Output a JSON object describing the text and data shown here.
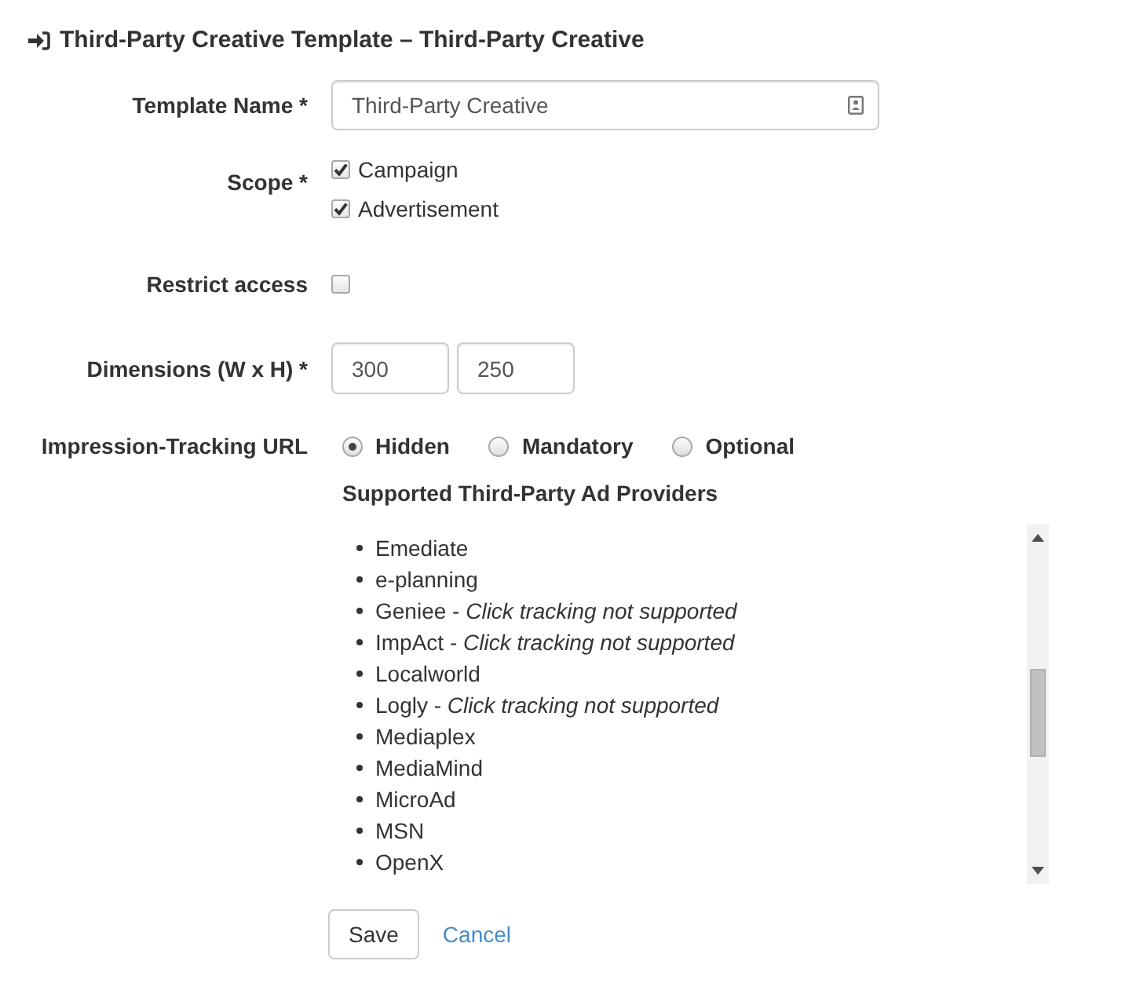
{
  "heading": {
    "title": "Third-Party Creative Template – Third-Party Creative"
  },
  "fields": [
    {
      "kind": "text",
      "label": "Template Name *",
      "value": "Third-Party Creative"
    },
    {
      "kind": "checkboxes",
      "label": "Scope *",
      "options": [
        {
          "label": "Campaign",
          "checked": true
        },
        {
          "label": "Advertisement",
          "checked": true
        }
      ]
    },
    {
      "kind": "checkbox",
      "label": "Restrict access",
      "checked": false
    },
    {
      "kind": "dimensions",
      "label": "Dimensions (W x H) *",
      "values": [
        "300",
        "250"
      ]
    },
    {
      "kind": "radios",
      "label": "Impression-Tracking URL",
      "options": [
        {
          "label": "Hidden",
          "selected": true
        },
        {
          "label": "Mandatory",
          "selected": false
        },
        {
          "label": "Optional",
          "selected": false
        }
      ]
    }
  ],
  "providers": {
    "title": "Supported Third-Party Ad Providers",
    "items": [
      "Emediate",
      "e-planning",
      "Geniee - *Click tracking not supported*",
      "ImpAct - *Click tracking not supported*",
      "Localworld",
      "Logly - *Click tracking not supported*",
      "Mediaplex",
      "MediaMind",
      "MicroAd",
      "MSN",
      "OpenX"
    ]
  },
  "actions": {
    "save": "Save",
    "cancel": "Cancel"
  }
}
